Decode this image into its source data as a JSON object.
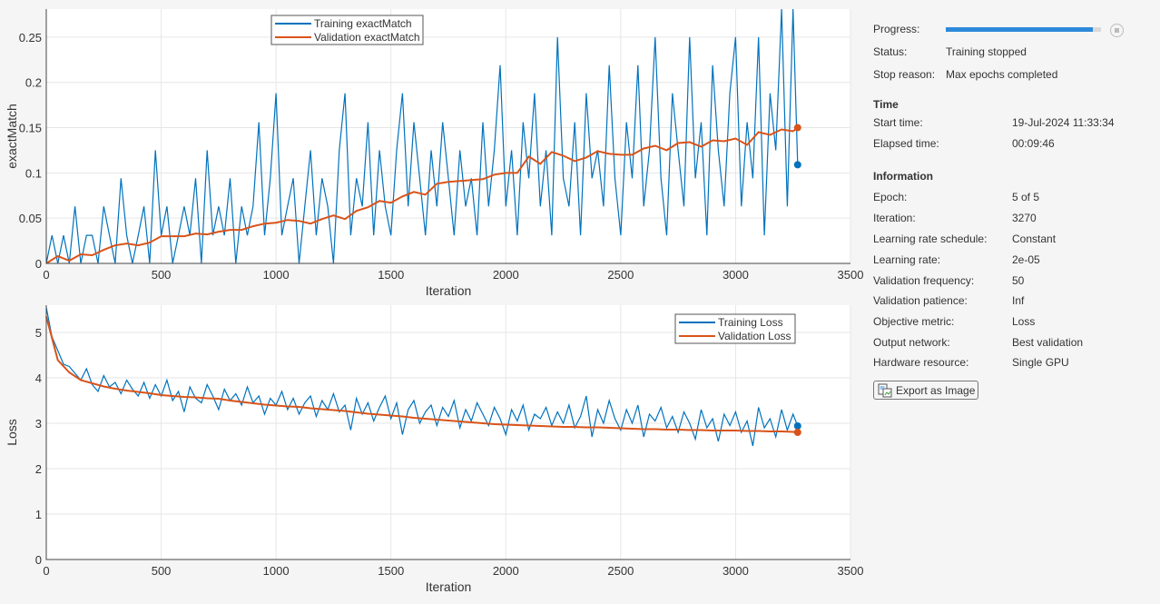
{
  "chart_data": [
    {
      "type": "line",
      "ylabel": "exactMatch",
      "xlabel": "Iteration",
      "xlim": [
        0,
        3500
      ],
      "ylim": [
        0,
        0.281
      ],
      "xticks": [
        "0",
        "500",
        "1000",
        "1500",
        "2000",
        "2500",
        "3000",
        "3500"
      ],
      "yticks": [
        "0",
        "0.05",
        "0.1",
        "0.15",
        "0.2",
        "0.25"
      ],
      "ytick_values": [
        0,
        0.05,
        0.1,
        0.15,
        0.2,
        0.25
      ],
      "grid": true,
      "legend_position": "top-center",
      "series": [
        {
          "name": "Training exactMatch",
          "color": "#0072bd",
          "x": [
            0,
            25,
            50,
            75,
            100,
            125,
            150,
            175,
            200,
            225,
            250,
            275,
            300,
            325,
            350,
            375,
            400,
            425,
            450,
            475,
            500,
            525,
            550,
            575,
            600,
            625,
            650,
            675,
            700,
            725,
            750,
            775,
            800,
            825,
            850,
            875,
            900,
            925,
            950,
            975,
            1000,
            1025,
            1050,
            1075,
            1100,
            1125,
            1150,
            1175,
            1200,
            1225,
            1250,
            1275,
            1300,
            1325,
            1350,
            1375,
            1400,
            1425,
            1450,
            1475,
            1500,
            1525,
            1550,
            1575,
            1600,
            1625,
            1650,
            1675,
            1700,
            1725,
            1750,
            1775,
            1800,
            1825,
            1850,
            1875,
            1900,
            1925,
            1950,
            1975,
            2000,
            2025,
            2050,
            2075,
            2100,
            2125,
            2150,
            2175,
            2200,
            2225,
            2250,
            2275,
            2300,
            2325,
            2350,
            2375,
            2400,
            2425,
            2450,
            2475,
            2500,
            2525,
            2550,
            2575,
            2600,
            2625,
            2650,
            2675,
            2700,
            2725,
            2750,
            2775,
            2800,
            2825,
            2850,
            2875,
            2900,
            2925,
            2950,
            2975,
            3000,
            3025,
            3050,
            3075,
            3100,
            3125,
            3150,
            3175,
            3200,
            3225,
            3250,
            3270
          ],
          "y": [
            0,
            0.031,
            0,
            0.031,
            0,
            0.063,
            0,
            0.031,
            0.031,
            0,
            0.063,
            0.031,
            0,
            0.094,
            0.031,
            0,
            0.031,
            0.063,
            0,
            0.125,
            0.031,
            0.063,
            0,
            0.031,
            0.063,
            0.031,
            0.094,
            0,
            0.125,
            0.031,
            0.063,
            0.031,
            0.094,
            0,
            0.063,
            0.031,
            0.063,
            0.156,
            0.031,
            0.094,
            0.188,
            0.031,
            0.063,
            0.094,
            0,
            0.063,
            0.125,
            0.031,
            0.094,
            0.063,
            0,
            0.125,
            0.188,
            0.031,
            0.094,
            0.063,
            0.156,
            0.031,
            0.125,
            0.063,
            0.031,
            0.125,
            0.188,
            0.063,
            0.156,
            0.094,
            0.031,
            0.125,
            0.063,
            0.156,
            0.094,
            0.031,
            0.125,
            0.063,
            0.094,
            0.031,
            0.156,
            0.063,
            0.125,
            0.219,
            0.063,
            0.125,
            0.031,
            0.156,
            0.094,
            0.188,
            0.063,
            0.125,
            0.031,
            0.25,
            0.094,
            0.063,
            0.156,
            0.031,
            0.188,
            0.094,
            0.125,
            0.063,
            0.219,
            0.094,
            0.031,
            0.156,
            0.094,
            0.219,
            0.063,
            0.125,
            0.25,
            0.094,
            0.031,
            0.188,
            0.125,
            0.063,
            0.25,
            0.094,
            0.156,
            0.031,
            0.219,
            0.125,
            0.063,
            0.188,
            0.25,
            0.063,
            0.156,
            0.094,
            0.25,
            0.031,
            0.188,
            0.125,
            0.281,
            0.063,
            0.281,
            0.109
          ]
        },
        {
          "name": "Validation exactMatch",
          "color": "#d95319",
          "x": [
            0,
            50,
            100,
            150,
            200,
            250,
            300,
            350,
            400,
            450,
            500,
            550,
            600,
            650,
            700,
            750,
            800,
            850,
            900,
            950,
            1000,
            1050,
            1100,
            1150,
            1200,
            1250,
            1300,
            1350,
            1400,
            1450,
            1500,
            1550,
            1600,
            1650,
            1700,
            1750,
            1800,
            1850,
            1900,
            1950,
            2000,
            2050,
            2100,
            2150,
            2200,
            2250,
            2300,
            2350,
            2400,
            2450,
            2500,
            2550,
            2600,
            2650,
            2700,
            2750,
            2800,
            2850,
            2900,
            2950,
            3000,
            3050,
            3100,
            3150,
            3200,
            3250,
            3270
          ],
          "y": [
            0,
            0.008,
            0.003,
            0.01,
            0.009,
            0.015,
            0.02,
            0.022,
            0.02,
            0.023,
            0.03,
            0.03,
            0.03,
            0.033,
            0.032,
            0.035,
            0.037,
            0.037,
            0.041,
            0.044,
            0.045,
            0.048,
            0.047,
            0.044,
            0.049,
            0.053,
            0.049,
            0.058,
            0.062,
            0.069,
            0.067,
            0.074,
            0.079,
            0.076,
            0.088,
            0.09,
            0.091,
            0.092,
            0.093,
            0.098,
            0.1,
            0.1,
            0.118,
            0.11,
            0.123,
            0.119,
            0.113,
            0.117,
            0.124,
            0.121,
            0.12,
            0.12,
            0.127,
            0.13,
            0.125,
            0.133,
            0.134,
            0.129,
            0.136,
            0.135,
            0.138,
            0.131,
            0.145,
            0.142,
            0.148,
            0.146,
            0.15
          ]
        }
      ]
    },
    {
      "type": "line",
      "ylabel": "Loss",
      "xlabel": "Iteration",
      "xlim": [
        0,
        3500
      ],
      "ylim": [
        0,
        5.6
      ],
      "xticks": [
        "0",
        "500",
        "1000",
        "1500",
        "2000",
        "2500",
        "3000",
        "3500"
      ],
      "yticks": [
        "0",
        "1",
        "2",
        "3",
        "4",
        "5"
      ],
      "ytick_values": [
        0,
        1,
        2,
        3,
        4,
        5
      ],
      "grid": true,
      "legend_position": "top-right",
      "series": [
        {
          "name": "Training Loss",
          "color": "#0072bd",
          "x": [
            0,
            25,
            50,
            75,
            100,
            125,
            150,
            175,
            200,
            225,
            250,
            275,
            300,
            325,
            350,
            375,
            400,
            425,
            450,
            475,
            500,
            525,
            550,
            575,
            600,
            625,
            650,
            675,
            700,
            725,
            750,
            775,
            800,
            825,
            850,
            875,
            900,
            925,
            950,
            975,
            1000,
            1025,
            1050,
            1075,
            1100,
            1125,
            1150,
            1175,
            1200,
            1225,
            1250,
            1275,
            1300,
            1325,
            1350,
            1375,
            1400,
            1425,
            1450,
            1475,
            1500,
            1525,
            1550,
            1575,
            1600,
            1625,
            1650,
            1675,
            1700,
            1725,
            1750,
            1775,
            1800,
            1825,
            1850,
            1875,
            1900,
            1925,
            1950,
            1975,
            2000,
            2025,
            2050,
            2075,
            2100,
            2125,
            2150,
            2175,
            2200,
            2225,
            2250,
            2275,
            2300,
            2325,
            2350,
            2375,
            2400,
            2425,
            2450,
            2475,
            2500,
            2525,
            2550,
            2575,
            2600,
            2625,
            2650,
            2675,
            2700,
            2725,
            2750,
            2775,
            2800,
            2825,
            2850,
            2875,
            2900,
            2925,
            2950,
            2975,
            3000,
            3025,
            3050,
            3075,
            3100,
            3125,
            3150,
            3175,
            3200,
            3225,
            3250,
            3270
          ],
          "y": [
            5.55,
            4.9,
            4.6,
            4.3,
            4.25,
            4.1,
            3.95,
            4.2,
            3.85,
            3.7,
            4.05,
            3.8,
            3.9,
            3.65,
            3.95,
            3.75,
            3.6,
            3.9,
            3.55,
            3.85,
            3.6,
            3.95,
            3.5,
            3.7,
            3.25,
            3.8,
            3.55,
            3.45,
            3.85,
            3.6,
            3.3,
            3.75,
            3.5,
            3.65,
            3.4,
            3.8,
            3.45,
            3.6,
            3.2,
            3.55,
            3.4,
            3.7,
            3.3,
            3.55,
            3.2,
            3.45,
            3.6,
            3.15,
            3.5,
            3.3,
            3.65,
            3.25,
            3.4,
            2.85,
            3.55,
            3.2,
            3.45,
            3.05,
            3.35,
            3.6,
            3.1,
            3.45,
            2.75,
            3.3,
            3.5,
            3.0,
            3.25,
            3.4,
            2.95,
            3.35,
            3.15,
            3.5,
            2.9,
            3.3,
            3.05,
            3.45,
            3.2,
            2.95,
            3.35,
            3.1,
            2.75,
            3.3,
            3.05,
            3.4,
            2.85,
            3.2,
            3.1,
            3.35,
            2.95,
            3.25,
            3.0,
            3.4,
            2.9,
            3.15,
            3.6,
            2.7,
            3.3,
            3.0,
            3.5,
            3.1,
            2.85,
            3.3,
            3.0,
            3.4,
            2.7,
            3.2,
            3.05,
            3.35,
            2.9,
            3.15,
            2.8,
            3.25,
            3.0,
            2.65,
            3.3,
            2.9,
            3.1,
            2.6,
            3.2,
            2.95,
            3.25,
            2.8,
            3.05,
            2.5,
            3.35,
            2.9,
            3.1,
            2.7,
            3.3,
            2.85,
            3.2,
            2.94
          ]
        },
        {
          "name": "Validation Loss",
          "color": "#d95319",
          "x": [
            0,
            50,
            100,
            150,
            200,
            250,
            300,
            350,
            400,
            450,
            500,
            550,
            600,
            650,
            700,
            750,
            800,
            850,
            900,
            950,
            1000,
            1050,
            1100,
            1150,
            1200,
            1250,
            1300,
            1350,
            1400,
            1450,
            1500,
            1550,
            1600,
            1650,
            1700,
            1750,
            1800,
            1850,
            1900,
            1950,
            2000,
            2050,
            2100,
            2150,
            2200,
            2250,
            2300,
            2350,
            2400,
            2450,
            2500,
            2550,
            2600,
            2650,
            2700,
            2750,
            2800,
            2850,
            2900,
            2950,
            3000,
            3050,
            3100,
            3150,
            3200,
            3250,
            3270
          ],
          "y": [
            5.35,
            4.39,
            4.12,
            3.95,
            3.88,
            3.81,
            3.76,
            3.72,
            3.69,
            3.66,
            3.62,
            3.6,
            3.58,
            3.57,
            3.55,
            3.54,
            3.5,
            3.47,
            3.44,
            3.41,
            3.39,
            3.37,
            3.36,
            3.33,
            3.31,
            3.29,
            3.27,
            3.24,
            3.21,
            3.19,
            3.17,
            3.15,
            3.12,
            3.1,
            3.08,
            3.06,
            3.04,
            3.02,
            3.0,
            2.98,
            2.97,
            2.96,
            2.95,
            2.94,
            2.93,
            2.92,
            2.92,
            2.91,
            2.91,
            2.9,
            2.89,
            2.88,
            2.87,
            2.87,
            2.86,
            2.86,
            2.85,
            2.85,
            2.84,
            2.84,
            2.84,
            2.83,
            2.83,
            2.82,
            2.82,
            2.81,
            2.8
          ]
        }
      ]
    }
  ],
  "panel": {
    "progress_label": "Progress:",
    "progress_value": 0.95,
    "status_label": "Status:",
    "status_value": "Training stopped",
    "stop_reason_label": "Stop reason:",
    "stop_reason_value": "Max epochs completed",
    "time_heading": "Time",
    "time": [
      {
        "label": "Start time:",
        "value": "19-Jul-2024 11:33:34"
      },
      {
        "label": "Elapsed time:",
        "value": "00:09:46"
      }
    ],
    "info_heading": "Information",
    "info": [
      {
        "label": "Epoch:",
        "value": "5 of 5"
      },
      {
        "label": "Iteration:",
        "value": "3270"
      },
      {
        "label": "Learning rate schedule:",
        "value": "Constant"
      },
      {
        "label": "Learning rate:",
        "value": "2e-05"
      },
      {
        "label": "Validation frequency:",
        "value": "50"
      },
      {
        "label": "Validation patience:",
        "value": "Inf"
      },
      {
        "label": "Objective metric:",
        "value": "Loss"
      },
      {
        "label": "Output network:",
        "value": "Best validation"
      },
      {
        "label": "Hardware resource:",
        "value": "Single GPU"
      }
    ],
    "export_label": "Export as Image"
  }
}
